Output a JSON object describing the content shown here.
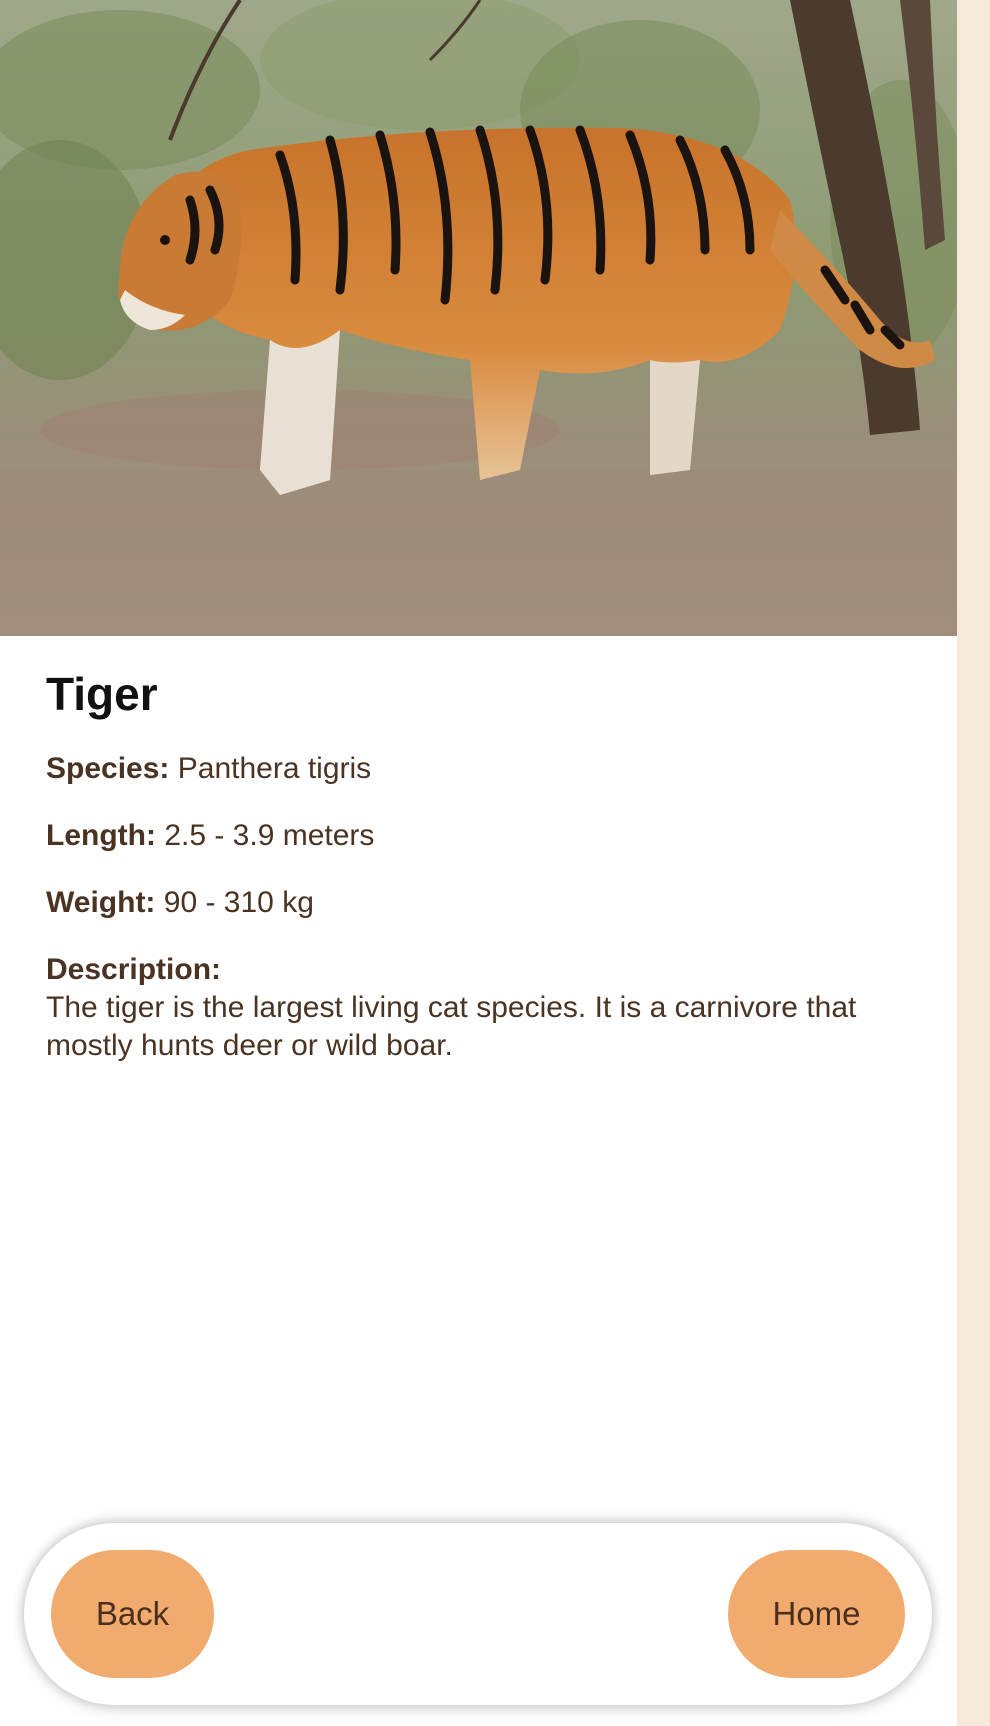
{
  "animal": {
    "name": "Tiger",
    "image_alt": "Tiger walking through forest",
    "species_label": "Species:",
    "species_value": "Panthera tigris",
    "length_label": "Length:",
    "length_value": "2.5 - 3.9 meters",
    "weight_label": "Weight:",
    "weight_value": "90 - 310 kg",
    "description_label": "Description:",
    "description_text": "The tiger is the largest living cat species. It is a carnivore that mostly hunts deer or wild boar."
  },
  "nav": {
    "back_label": "Back",
    "home_label": "Home"
  },
  "colors": {
    "accent": "#f2ab6f",
    "text": "#4a3322",
    "page_bg": "#f7e8dc"
  }
}
